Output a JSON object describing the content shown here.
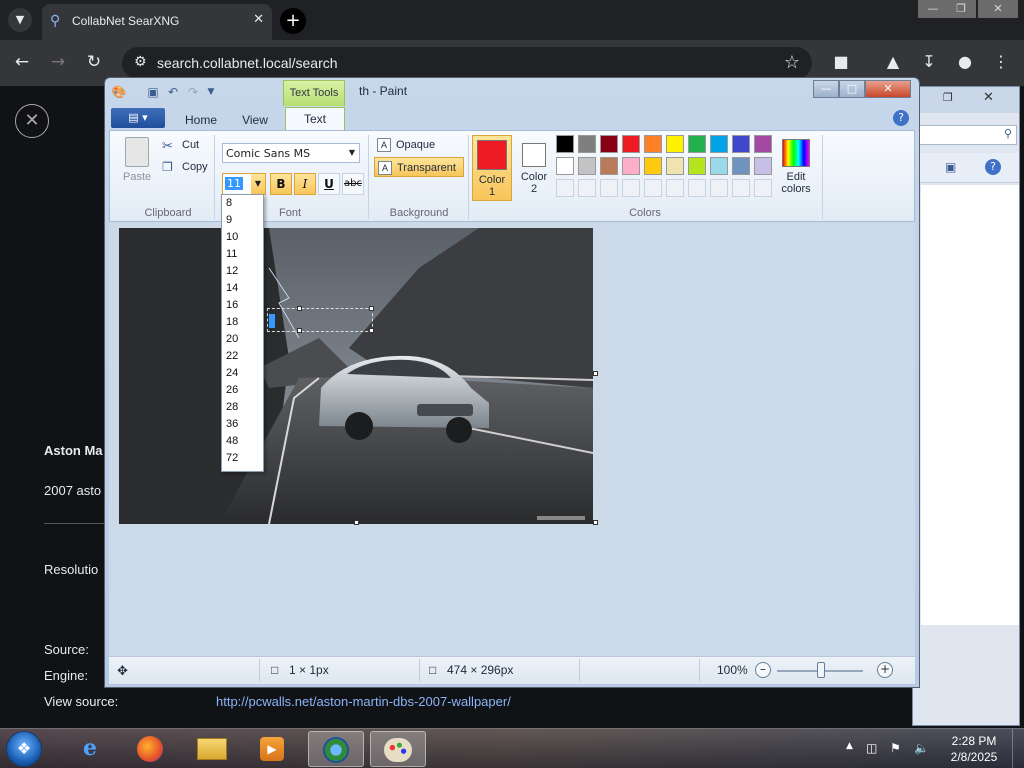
{
  "browser": {
    "tab_title": "CollabNet SearXNG",
    "url": "search.collabnet.local/search"
  },
  "page": {
    "title_partial": "Aston Ma",
    "desc_partial": "2007 asto",
    "resolution_label": "Resolutio",
    "source_label": "Source:",
    "engine_label": "Engine:",
    "view_source_label": "View source:",
    "view_source_url": "http://pcwalls.net/aston-martin-dbs-2007-wallpaper/"
  },
  "paint": {
    "context_tab": "Text Tools",
    "window_title": "th - Paint",
    "tabs": [
      "Home",
      "View",
      "Text"
    ],
    "clipboard": {
      "paste": "Paste",
      "cut": "Cut",
      "copy": "Copy",
      "label": "Clipboard"
    },
    "font": {
      "family": "Comic Sans MS",
      "size": "11",
      "label": "Font",
      "bold": "B",
      "italic": "I",
      "underline": "U",
      "strike": "abc"
    },
    "background": {
      "opaque": "Opaque",
      "transparent": "Transparent",
      "label": "Background"
    },
    "colors": {
      "color1_label": "Color",
      "color1_num": "1",
      "color2_label": "Color",
      "color2_num": "2",
      "edit_label": "Edit",
      "edit_label2": "colors",
      "label": "Colors",
      "color1": "#ed1c24",
      "color2": "#ffffff"
    },
    "palette_row1": [
      "#000000",
      "#7f7f7f",
      "#880015",
      "#ed1c24",
      "#ff7f27",
      "#fff200",
      "#22b14c",
      "#00a2e8",
      "#3f48cc",
      "#a349a4"
    ],
    "palette_row2": [
      "#ffffff",
      "#c3c3c3",
      "#b97a57",
      "#ffaec9",
      "#ffc90e",
      "#efe4b0",
      "#b5e61d",
      "#99d9ea",
      "#7092be",
      "#c8bfe7"
    ],
    "font_sizes": [
      "8",
      "9",
      "10",
      "11",
      "12",
      "14",
      "16",
      "18",
      "20",
      "22",
      "24",
      "26",
      "28",
      "36",
      "48",
      "72"
    ],
    "status": {
      "selection": "1 × 1px",
      "image_size": "474 × 296px",
      "zoom": "100%"
    }
  },
  "taskbar": {
    "time": "2:28 PM",
    "date": "2/8/2025"
  }
}
